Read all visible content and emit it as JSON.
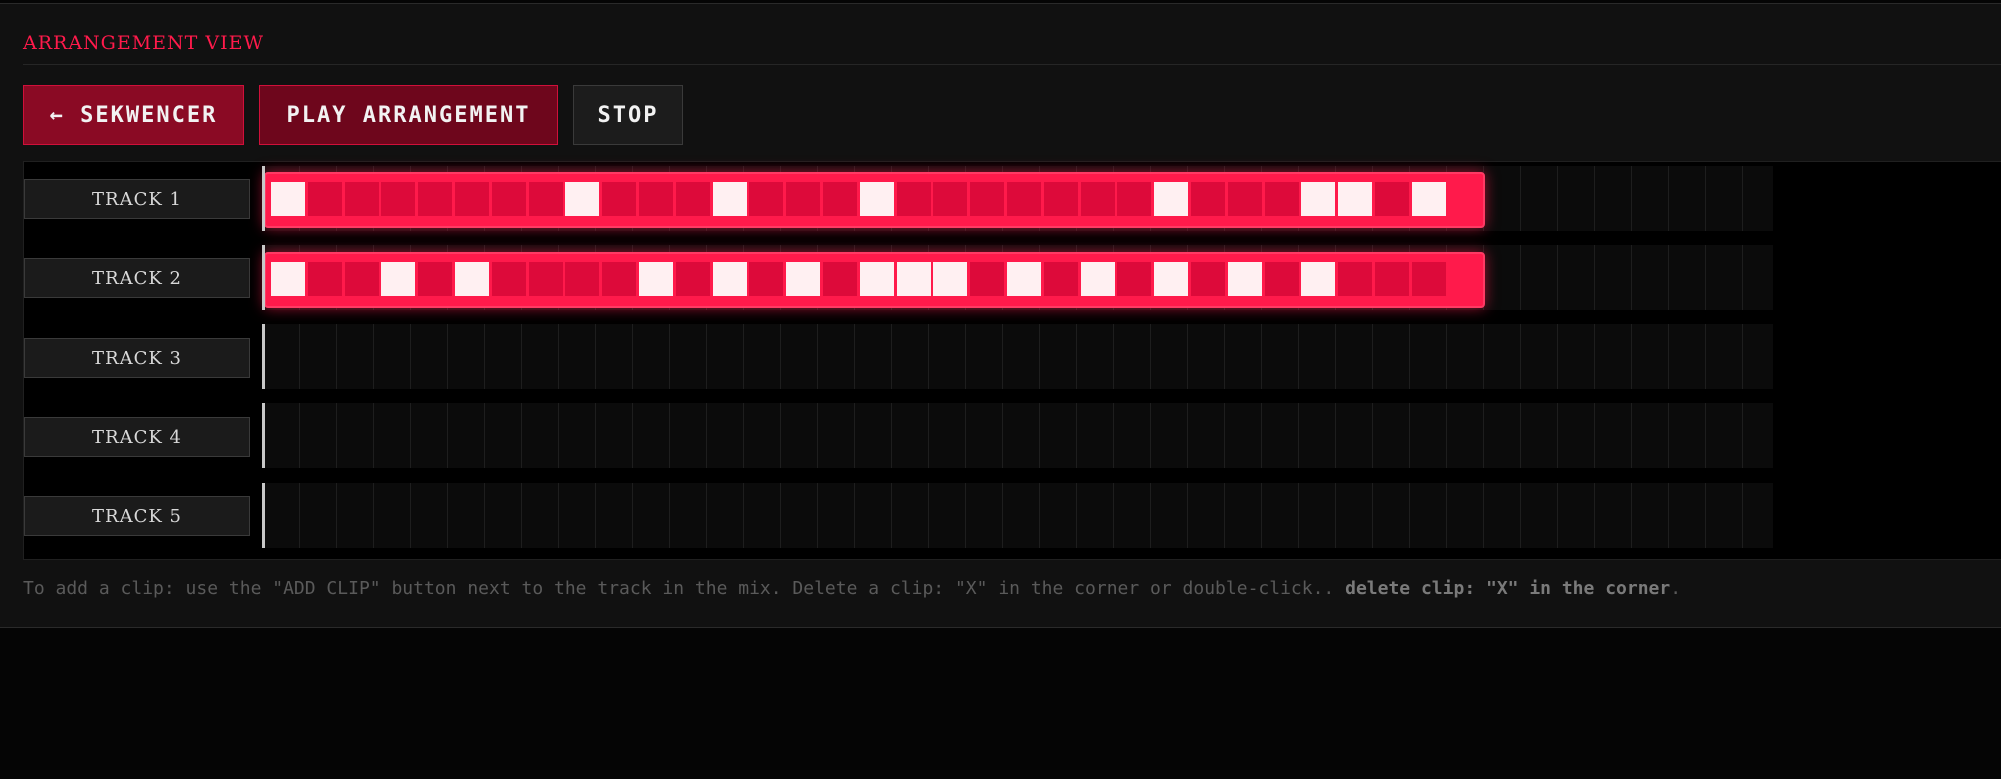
{
  "panel": {
    "title": "ARRANGEMENT VIEW"
  },
  "toolbar": {
    "back_label": "← SEKWENCER",
    "play_label": "PLAY ARRANGEMENT",
    "stop_label": "STOP"
  },
  "colors": {
    "accent": "#ff1a4b",
    "clip_step_off": "#dd0a3a",
    "clip_step_on": "#fff0f2"
  },
  "tracks": [
    {
      "label": "TRACK 1",
      "clip": {
        "steps": 32,
        "active": [
          0,
          8,
          12,
          16,
          24,
          28,
          29,
          31
        ]
      }
    },
    {
      "label": "TRACK 2",
      "clip": {
        "steps": 32,
        "active": [
          0,
          3,
          5,
          10,
          12,
          14,
          16,
          17,
          18,
          20,
          22,
          24,
          26,
          28
        ]
      }
    },
    {
      "label": "TRACK 3",
      "clip": null
    },
    {
      "label": "TRACK 4",
      "clip": null
    },
    {
      "label": "TRACK 5",
      "clip": null
    }
  ],
  "footer": {
    "text": "To add a clip: use the \"ADD CLIP\" button next to the track in the mix. Delete a clip: \"X\" in the corner or double-click.. ",
    "bold": "delete clip: \"X\" in the corner",
    "end": "."
  }
}
